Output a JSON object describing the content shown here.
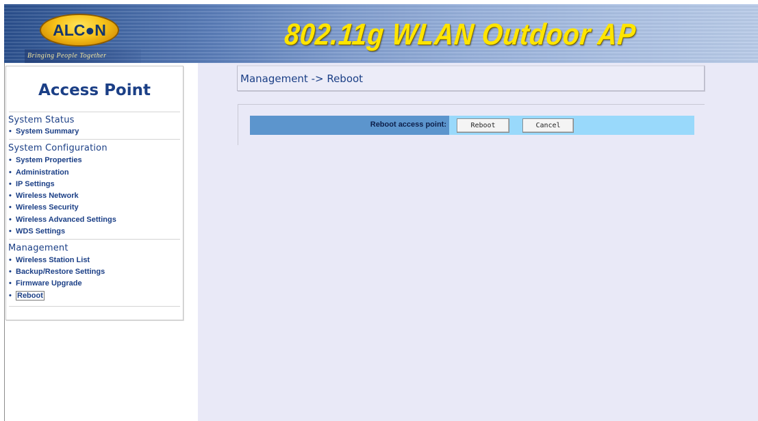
{
  "header": {
    "logo_text": "ALC●N",
    "logo_tagline": "Bringing People Together",
    "title": "802.11g WLAN Outdoor AP",
    "colors": {
      "title": "#ffe500",
      "banner": "#3a5f9c",
      "logo": "#f7c21a"
    }
  },
  "sidebar": {
    "title": "Access Point",
    "sections": [
      {
        "heading": "System Status",
        "items": [
          {
            "label": "System Summary"
          }
        ]
      },
      {
        "heading": "System Configuration",
        "items": [
          {
            "label": "System Properties"
          },
          {
            "label": "Administration"
          },
          {
            "label": "IP Settings"
          },
          {
            "label": "Wireless Network"
          },
          {
            "label": "Wireless Security"
          },
          {
            "label": "Wireless Advanced Settings"
          },
          {
            "label": "WDS Settings"
          }
        ]
      },
      {
        "heading": "Management",
        "items": [
          {
            "label": "Wireless Station List"
          },
          {
            "label": "Backup/Restore Settings"
          },
          {
            "label": "Firmware Upgrade"
          },
          {
            "label": "Reboot"
          }
        ]
      }
    ],
    "bullet": "•",
    "current_item": "Reboot"
  },
  "main": {
    "breadcrumb": "Management -> Reboot",
    "action_label": "Reboot access point:",
    "reboot_button": "Reboot",
    "cancel_button": "Cancel",
    "colors": {
      "label_cell": "#5c95cd",
      "row": "#99d9fb",
      "background": "#e9e9f7"
    }
  }
}
